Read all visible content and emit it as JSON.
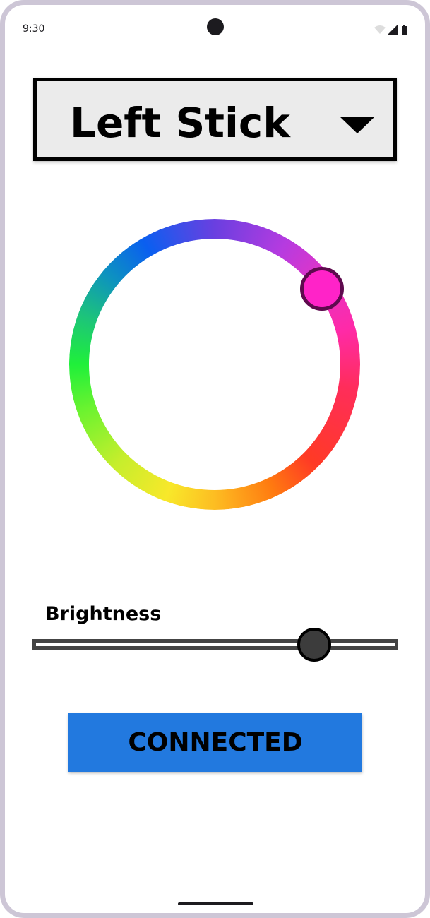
{
  "status_bar": {
    "time": "9:30",
    "icons": [
      "wifi-icon",
      "signal-icon",
      "battery-icon"
    ]
  },
  "stick_selector": {
    "selected": "Left Stick",
    "icon": "dropdown-arrow-icon"
  },
  "color_wheel": {
    "selected_color": "#ff23c8",
    "thumb_border_color": "#5e0a4e"
  },
  "brightness": {
    "label": "Brightness",
    "value_percent": 77
  },
  "connection": {
    "label": "CONNECTED",
    "color": "#2279df"
  }
}
